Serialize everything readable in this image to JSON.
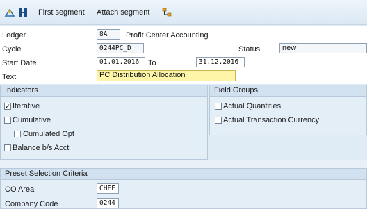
{
  "toolbar": {
    "first_segment_label": "First segment",
    "attach_segment_label": "Attach segment"
  },
  "header": {
    "ledger_label": "Ledger",
    "ledger_value": "8A",
    "ledger_desc": "Profit Center Accounting",
    "cycle_label": "Cycle",
    "cycle_value": "0244PC_D",
    "status_label": "Status",
    "status_value": "new",
    "start_date_label": "Start Date",
    "start_date_value": "01.01.2016",
    "to_label": "To",
    "end_date_value": "31.12.2016",
    "text_label": "Text",
    "text_value": "PC Distribution Allocation"
  },
  "indicators": {
    "title": "Indicators",
    "items": [
      {
        "label": "Iterative",
        "checked": true
      },
      {
        "label": "Cumulative",
        "checked": false
      },
      {
        "label": "Cumulated Opt",
        "checked": false
      },
      {
        "label": "Balance b/s Acct",
        "checked": false
      }
    ]
  },
  "field_groups": {
    "title": "Field Groups",
    "items": [
      {
        "label": "Actual Quantities",
        "checked": false
      },
      {
        "label": "Actual Transaction Currency",
        "checked": false
      }
    ]
  },
  "preset": {
    "title": "Preset Selection Criteria",
    "co_area_label": "CO Area",
    "co_area_value": "CHEF",
    "company_code_label": "Company Code",
    "company_code_value": "0244"
  },
  "colors": {
    "background": "#dfebf5",
    "group_title": "#d2e1ef",
    "highlight_field": "#fff5a8"
  }
}
